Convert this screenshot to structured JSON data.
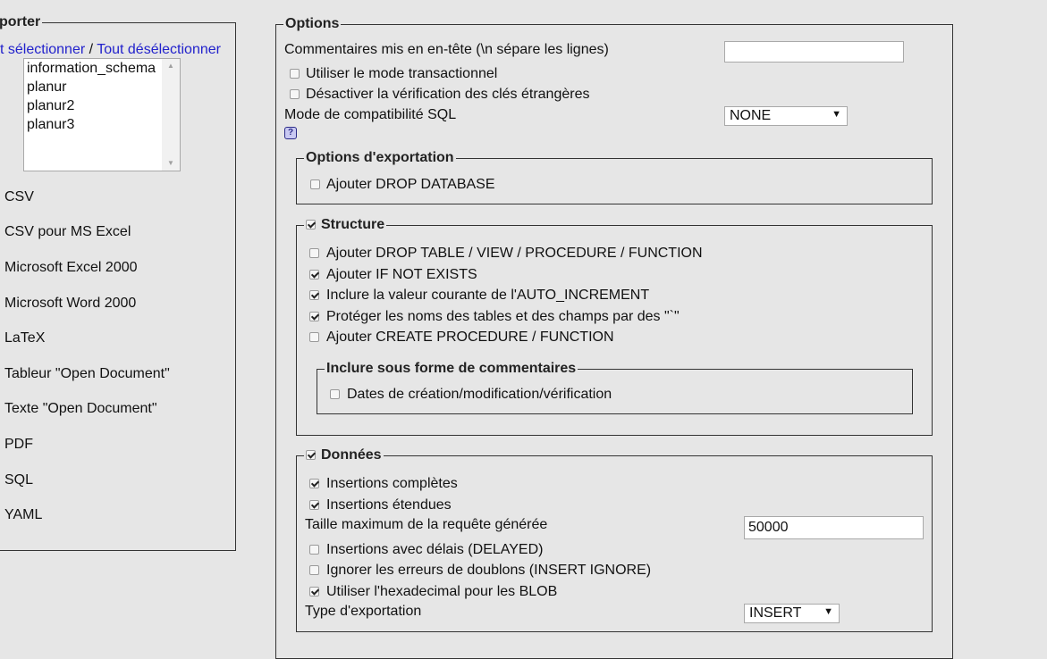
{
  "left": {
    "legend": "porter",
    "select_all": "t sélectionner",
    "separator": " / ",
    "deselect_all": "Tout désélectionner",
    "databases": [
      "information_schema",
      "planur",
      "planur2",
      "planur3"
    ],
    "formats": [
      "CSV",
      "CSV pour MS Excel",
      "Microsoft Excel 2000",
      "Microsoft Word 2000",
      "LaTeX",
      "Tableur \"Open Document\"",
      "Texte \"Open Document\"",
      "PDF",
      "SQL",
      "YAML"
    ]
  },
  "options": {
    "legend": "Options",
    "header_comment_label": "Commentaires mis en en-tête (\\n sépare les lignes)",
    "header_comment_value": "",
    "use_transaction": "Utiliser le mode transactionnel",
    "disable_fk": "Désactiver la vérification des clés étrangères",
    "compat_label": "Mode de compatibilité SQL",
    "compat_value": "NONE",
    "help": "?"
  },
  "export_options": {
    "legend": "Options d'exportation",
    "drop_database": "Ajouter DROP DATABASE"
  },
  "structure": {
    "legend": "Structure",
    "checked": true,
    "items": [
      {
        "label": "Ajouter DROP TABLE / VIEW / PROCEDURE / FUNCTION",
        "checked": false
      },
      {
        "label": "Ajouter IF NOT EXISTS",
        "checked": true
      },
      {
        "label": "Inclure la valeur courante de l'AUTO_INCREMENT",
        "checked": true
      },
      {
        "label": "Protéger les noms des tables et des champs par des \"`\"",
        "checked": true
      },
      {
        "label": "Ajouter CREATE PROCEDURE / FUNCTION",
        "checked": false
      }
    ],
    "comments_legend": "Inclure sous forme de commentaires",
    "dates_label": "Dates de création/modification/vérification"
  },
  "data": {
    "legend": "Données",
    "checked": true,
    "complete_inserts": "Insertions complètes",
    "extended_inserts": "Insertions étendues",
    "max_query_label": "Taille maximum de la requête générée",
    "max_query_value": "50000",
    "delayed": "Insertions avec délais (DELAYED)",
    "ignore": "Ignorer les erreurs de doublons (INSERT IGNORE)",
    "hex_blob": "Utiliser l'hexadecimal pour les BLOB",
    "export_type_label": "Type d'exportation",
    "export_type_value": "INSERT"
  }
}
